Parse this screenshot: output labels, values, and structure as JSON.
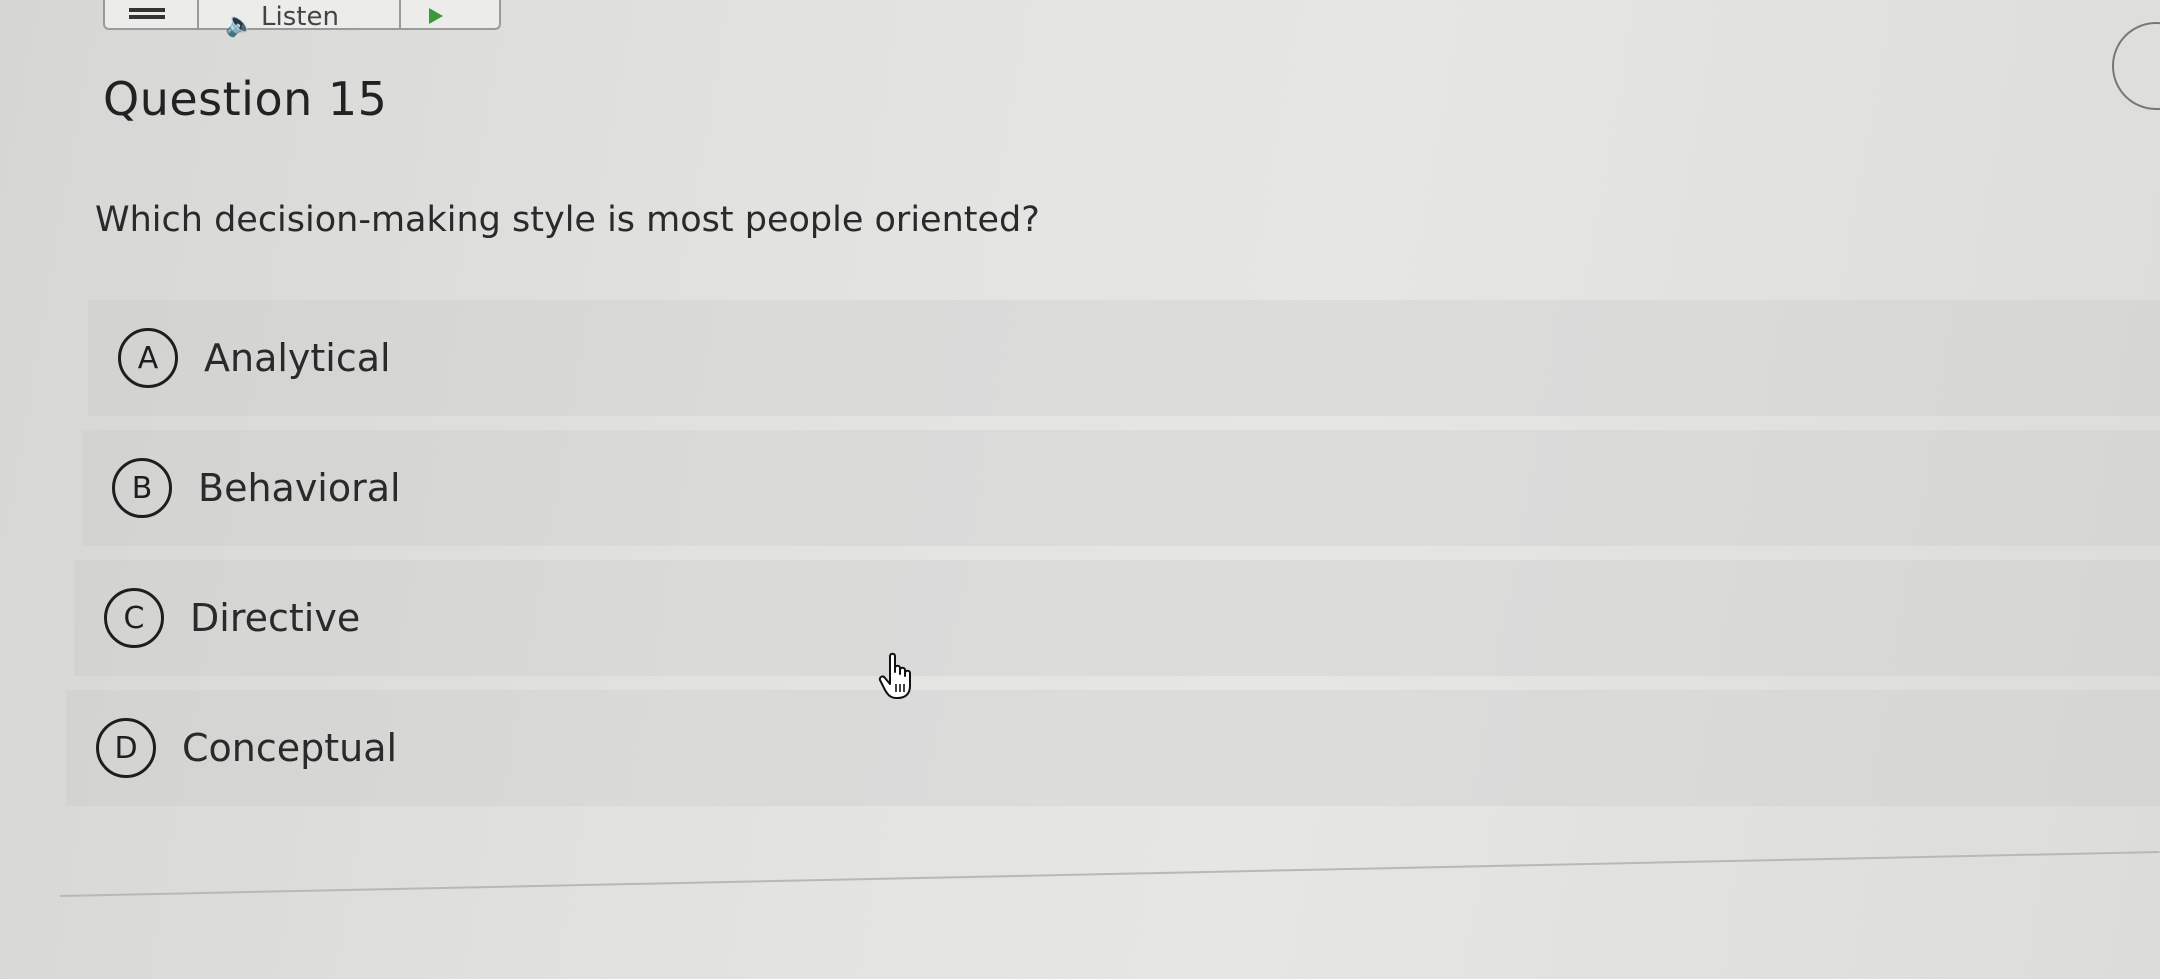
{
  "toolbar": {
    "menu_icon": "menu-icon",
    "listen_icon": "speaker-icon",
    "listen_label": "Listen",
    "play_icon": "play-icon"
  },
  "question": {
    "title": "Question 15",
    "prompt": "Which decision-making style is most people oriented?"
  },
  "options": [
    {
      "letter": "A",
      "label": "Analytical"
    },
    {
      "letter": "B",
      "label": "Behavioral"
    },
    {
      "letter": "C",
      "label": "Directive"
    },
    {
      "letter": "D",
      "label": "Conceptual"
    }
  ],
  "cursor_icon": "hand-pointer-icon",
  "colors": {
    "background": "#e2e2e0",
    "text": "#2a2a2a",
    "option_circle": "#1e1e1e",
    "play_accent": "#3a9a3a"
  }
}
